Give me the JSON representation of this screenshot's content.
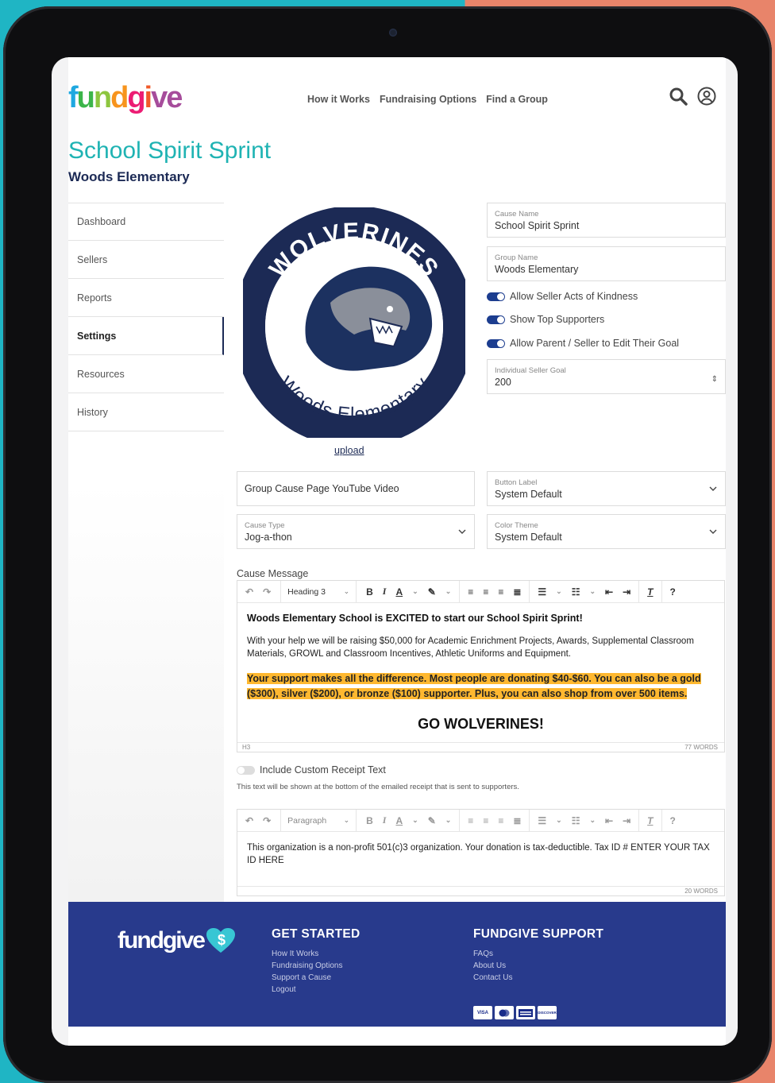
{
  "brand": {
    "logo_letters": [
      "f",
      "u",
      "n",
      "d",
      "g",
      "i",
      "ve"
    ]
  },
  "nav": {
    "items": [
      "How it Works",
      "Fundraising Options",
      "Find a Group"
    ]
  },
  "page": {
    "title": "School Spirit Sprint",
    "subtitle": "Woods Elementary"
  },
  "sidebar": {
    "items": [
      {
        "label": "Dashboard"
      },
      {
        "label": "Sellers"
      },
      {
        "label": "Reports"
      },
      {
        "label": "Settings",
        "active": true
      },
      {
        "label": "Resources"
      },
      {
        "label": "History"
      }
    ]
  },
  "badge": {
    "top_text": "WOLVERINES",
    "bottom_text": "Woods Elementary"
  },
  "upload_label": "upload",
  "fields": {
    "cause_name": {
      "label": "Cause Name",
      "value": "School Spirit Sprint"
    },
    "group_name": {
      "label": "Group Name",
      "value": "Woods Elementary"
    },
    "seller_goal": {
      "label": "Individual Seller Goal",
      "value": "200"
    },
    "youtube": {
      "placeholder": "Group Cause Page YouTube Video"
    },
    "button_label": {
      "label": "Button Label",
      "value": "System Default"
    },
    "cause_type": {
      "label": "Cause Type",
      "value": "Jog-a-thon"
    },
    "color_theme": {
      "label": "Color Theme",
      "value": "System Default"
    }
  },
  "toggles": [
    {
      "label": "Allow Seller Acts of Kindness",
      "on": true
    },
    {
      "label": "Show Top Supporters",
      "on": true
    },
    {
      "label": "Allow Parent / Seller to Edit Their Goal",
      "on": true
    }
  ],
  "cause_message": {
    "label": "Cause Message",
    "block_format": "Heading 3",
    "heading": "Woods Elementary School is EXCITED to start our School Spirit Sprint!",
    "paragraph": "With your help we will be raising $50,000 for Academic Enrichment Projects, Awards, Supplemental Classroom Materials, GROWL and Classroom Incentives, Athletic Uniforms and Equipment.",
    "highlight": "Your support makes all the difference. Most people are donating $40-$60. You can also be a gold ($300), silver ($200), or bronze ($100) supporter. Plus, you can also shop from over 500 items.",
    "cutoff": "GO WOLVERINES!",
    "status_left": "H3",
    "status_right": "77 WORDS"
  },
  "receipt": {
    "toggle_label": "Include Custom Receipt Text",
    "toggle_on": false,
    "note": "This text will be shown at the bottom of the emailed receipt that is sent to supporters.",
    "block_format": "Paragraph",
    "body": "This organization is a non-profit 501(c)3 organization. Your donation is tax-deductible. Tax ID # ENTER YOUR TAX ID HERE",
    "status_right": "20 WORDS"
  },
  "footer": {
    "logo_text": "fundgive",
    "get_started": {
      "title": "GET STARTED",
      "links": [
        "How It Works",
        "Fundraising Options",
        "Support a Cause",
        "Logout"
      ]
    },
    "support": {
      "title": "FUNDGIVE SUPPORT",
      "links": [
        "FAQs",
        "About Us",
        "Contact Us"
      ]
    },
    "cards": [
      "VISA",
      "MC",
      "AMEX",
      "DISCOVER"
    ]
  },
  "colors": {
    "accent": "#1fb3b3",
    "navy": "#1c2a55",
    "footer_bg": "#283a8c",
    "highlight": "#ffb830",
    "toggle_on": "#1c3d8f"
  }
}
